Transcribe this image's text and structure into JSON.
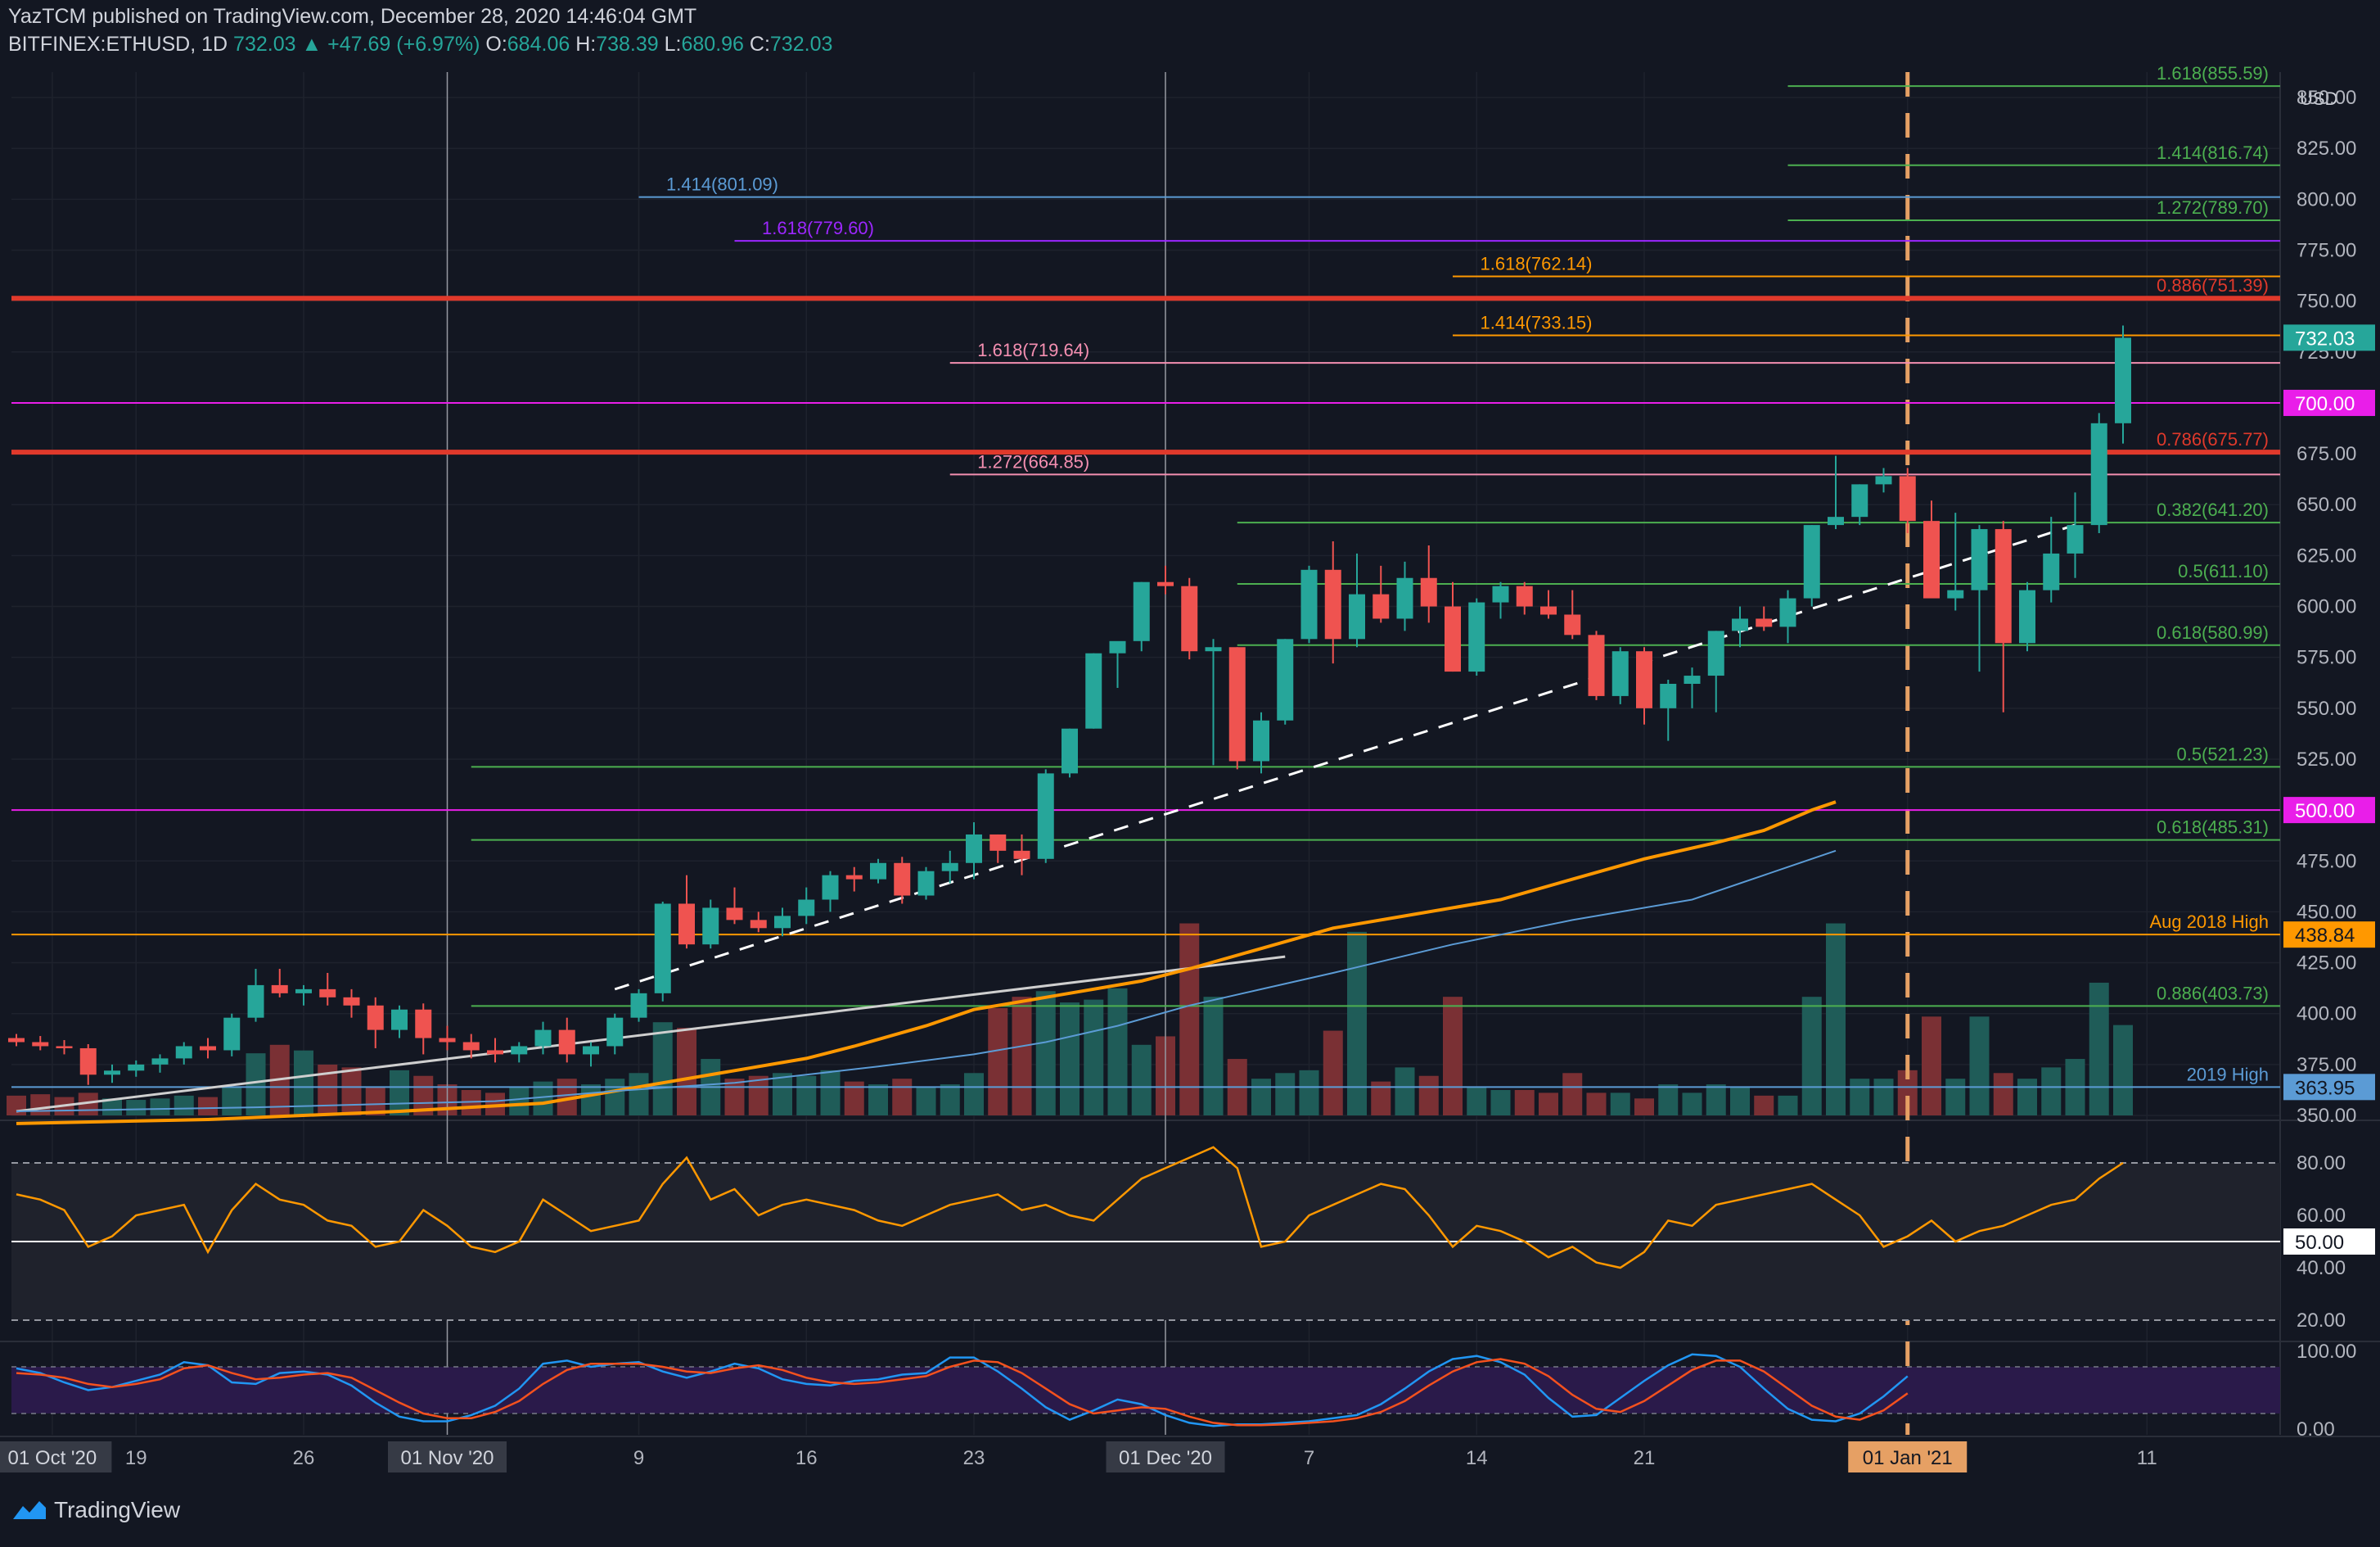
{
  "header": {
    "publisher_line": "YazTCM published on TradingView.com, December 28, 2020 14:46:04 GMT",
    "symbol": "BITFINEX:ETHUSD, 1D",
    "last": "732.03",
    "change_arrow": "▲",
    "change": "+47.69 (+6.97%)",
    "open_label": "O:",
    "open": "684.06",
    "high_label": "H:",
    "high": "738.39",
    "low_label": "L:",
    "low": "680.96",
    "close_label": "C:",
    "close": "732.03"
  },
  "footer": {
    "brand": "TradingView"
  },
  "colors": {
    "background": "#131722",
    "up": "#26a69a",
    "down": "#ef5350",
    "vol_up": "#1f5c58",
    "vol_down": "#7a3034",
    "resistance": "#e0392b",
    "magenta": "#e91ee9",
    "orange": "#ff9800",
    "green_fib": "#4caf50",
    "pink_fib": "#f48fb1",
    "blue_fib": "#5b9bd5",
    "purple_fib": "#9c27ff",
    "rsi": "#ff9800",
    "stoch_k": "#2196f3",
    "stoch_d": "#f4511e",
    "dashed_vertical": "#e6a064"
  },
  "chart_data": {
    "type": "candlestick",
    "currency": "USD",
    "y_axis": {
      "min": 350,
      "max": 862.5,
      "ticks": [
        "350.00",
        "375.00",
        "400.00",
        "425.00",
        "450.00",
        "475.00",
        "500.00",
        "525.00",
        "550.00",
        "575.00",
        "600.00",
        "625.00",
        "650.00",
        "675.00",
        "700.00",
        "725.00",
        "750.00",
        "775.00",
        "800.00",
        "825.00",
        "850.00"
      ]
    },
    "x_ticks": [
      {
        "label": "01 Oct '20",
        "idx": 1.5,
        "boxed": true
      },
      {
        "label": "19",
        "idx": 5
      },
      {
        "label": "26",
        "idx": 12
      },
      {
        "label": "01 Nov '20",
        "idx": 18,
        "boxed": true
      },
      {
        "label": "9",
        "idx": 26
      },
      {
        "label": "16",
        "idx": 33
      },
      {
        "label": "23",
        "idx": 40
      },
      {
        "label": "01 Dec '20",
        "idx": 48,
        "boxed": true
      },
      {
        "label": "7",
        "idx": 54
      },
      {
        "label": "14",
        "idx": 61
      },
      {
        "label": "21",
        "idx": 68
      },
      {
        "label": "01 Jan '21",
        "idx": 79,
        "boxed": true,
        "accent": true
      },
      {
        "label": "11",
        "idx": 89
      }
    ],
    "candles": [
      [
        388,
        390,
        384,
        386
      ],
      [
        386,
        389,
        382,
        384
      ],
      [
        384,
        387,
        380,
        383
      ],
      [
        383,
        385,
        365,
        370
      ],
      [
        370,
        375,
        366,
        372
      ],
      [
        372,
        377,
        369,
        375
      ],
      [
        375,
        380,
        371,
        378
      ],
      [
        378,
        386,
        375,
        384
      ],
      [
        384,
        388,
        378,
        382
      ],
      [
        382,
        400,
        379,
        398
      ],
      [
        398,
        422,
        396,
        414
      ],
      [
        414,
        422,
        408,
        410
      ],
      [
        410,
        414,
        404,
        412
      ],
      [
        412,
        420,
        404,
        408
      ],
      [
        408,
        412,
        398,
        404
      ],
      [
        404,
        408,
        383,
        392
      ],
      [
        392,
        404,
        388,
        402
      ],
      [
        402,
        405,
        380,
        388
      ],
      [
        388,
        394,
        382,
        386
      ],
      [
        386,
        390,
        378,
        382
      ],
      [
        382,
        388,
        376,
        380
      ],
      [
        380,
        386,
        376,
        384
      ],
      [
        384,
        396,
        380,
        392
      ],
      [
        392,
        398,
        376,
        380
      ],
      [
        380,
        386,
        374,
        384
      ],
      [
        384,
        400,
        380,
        398
      ],
      [
        398,
        412,
        396,
        410
      ],
      [
        410,
        455,
        406,
        454
      ],
      [
        454,
        468,
        432,
        434
      ],
      [
        434,
        456,
        432,
        452
      ],
      [
        452,
        462,
        444,
        446
      ],
      [
        446,
        450,
        440,
        442
      ],
      [
        442,
        452,
        438,
        448
      ],
      [
        448,
        462,
        444,
        456
      ],
      [
        456,
        470,
        450,
        468
      ],
      [
        468,
        472,
        460,
        466
      ],
      [
        466,
        476,
        464,
        474
      ],
      [
        474,
        477,
        454,
        458
      ],
      [
        458,
        472,
        456,
        470
      ],
      [
        470,
        480,
        464,
        474
      ],
      [
        474,
        494,
        466,
        488
      ],
      [
        488,
        488,
        474,
        480
      ],
      [
        480,
        488,
        468,
        476
      ],
      [
        476,
        520,
        474,
        518
      ],
      [
        518,
        540,
        516,
        540
      ],
      [
        540,
        577,
        540,
        577
      ],
      [
        577,
        582,
        560,
        583
      ],
      [
        583,
        612,
        578,
        612
      ],
      [
        612,
        620,
        606,
        610
      ],
      [
        610,
        614,
        574,
        578
      ],
      [
        578,
        584,
        522,
        580
      ],
      [
        580,
        580,
        520,
        524
      ],
      [
        524,
        548,
        518,
        544
      ],
      [
        544,
        584,
        542,
        584
      ],
      [
        584,
        620,
        582,
        618
      ],
      [
        618,
        632,
        572,
        584
      ],
      [
        584,
        626,
        580,
        606
      ],
      [
        606,
        620,
        592,
        594
      ],
      [
        594,
        622,
        588,
        614
      ],
      [
        614,
        630,
        592,
        600
      ],
      [
        600,
        612,
        568,
        568
      ],
      [
        568,
        604,
        566,
        602
      ],
      [
        602,
        612,
        594,
        610
      ],
      [
        610,
        612,
        596,
        600
      ],
      [
        600,
        608,
        594,
        596
      ],
      [
        596,
        608,
        584,
        586
      ],
      [
        586,
        588,
        554,
        556
      ],
      [
        556,
        580,
        552,
        578
      ],
      [
        578,
        580,
        542,
        550
      ],
      [
        550,
        564,
        534,
        562
      ],
      [
        562,
        570,
        550,
        566
      ],
      [
        566,
        588,
        548,
        588
      ],
      [
        588,
        600,
        580,
        594
      ],
      [
        594,
        600,
        588,
        590
      ],
      [
        590,
        608,
        582,
        604
      ],
      [
        604,
        640,
        600,
        640
      ],
      [
        640,
        674,
        638,
        644
      ],
      [
        644,
        660,
        640,
        660
      ],
      [
        660,
        668,
        656,
        664
      ],
      [
        664,
        668,
        636,
        642
      ],
      [
        642,
        652,
        620,
        604
      ],
      [
        604,
        646,
        598,
        608
      ],
      [
        608,
        640,
        568,
        638
      ],
      [
        638,
        642,
        548,
        582
      ],
      [
        582,
        612,
        578,
        608
      ],
      [
        608,
        644,
        602,
        626
      ],
      [
        626,
        656,
        614,
        640
      ],
      [
        640,
        695,
        636,
        690
      ],
      [
        690,
        738,
        680,
        732
      ]
    ],
    "volume_max": 145,
    "volumes": [
      14,
      15,
      13,
      16,
      12,
      11,
      12,
      14,
      13,
      20,
      44,
      50,
      46,
      36,
      34,
      20,
      32,
      28,
      22,
      18,
      16,
      20,
      24,
      26,
      22,
      26,
      30,
      66,
      62,
      40,
      26,
      28,
      30,
      28,
      32,
      24,
      22,
      26,
      20,
      22,
      30,
      76,
      84,
      88,
      80,
      82,
      90,
      50,
      56,
      136,
      84,
      40,
      26,
      30,
      32,
      60,
      130,
      24,
      34,
      28,
      84,
      20,
      18,
      18,
      16,
      30,
      16,
      16,
      12,
      22,
      16,
      22,
      20,
      14,
      14,
      84,
      136,
      26,
      26,
      32,
      70,
      26,
      70,
      30,
      26,
      34,
      40,
      94,
      64
    ],
    "sma_short": [
      [
        0,
        352
      ],
      [
        10,
        354
      ],
      [
        20,
        357
      ],
      [
        25,
        362
      ],
      [
        30,
        366
      ],
      [
        33,
        370
      ],
      [
        36,
        374
      ],
      [
        40,
        380
      ],
      [
        43,
        386
      ],
      [
        46,
        394
      ],
      [
        49,
        404
      ],
      [
        52,
        412
      ],
      [
        55,
        420
      ],
      [
        60,
        434
      ],
      [
        65,
        446
      ],
      [
        70,
        456
      ],
      [
        74,
        472
      ],
      [
        76,
        480
      ]
    ],
    "sma_long": [
      [
        0,
        346
      ],
      [
        8,
        348
      ],
      [
        16,
        352
      ],
      [
        22,
        356
      ],
      [
        26,
        364
      ],
      [
        30,
        372
      ],
      [
        33,
        378
      ],
      [
        35,
        384
      ],
      [
        38,
        394
      ],
      [
        40,
        402
      ],
      [
        42,
        406
      ],
      [
        44,
        410
      ],
      [
        47,
        416
      ],
      [
        49,
        422
      ],
      [
        52,
        432
      ],
      [
        55,
        442
      ],
      [
        58,
        448
      ],
      [
        62,
        456
      ],
      [
        65,
        466
      ],
      [
        68,
        476
      ],
      [
        71,
        484
      ],
      [
        73,
        490
      ],
      [
        75,
        500
      ],
      [
        76,
        504
      ]
    ],
    "trendlines": [
      {
        "name": "white-solid",
        "from": [
          0,
          352
        ],
        "to": [
          53,
          428
        ],
        "color": "#cfcfcf",
        "dash": false
      },
      {
        "name": "white-dashed",
        "from": [
          25,
          412
        ],
        "to": [
          86,
          640
        ],
        "color": "#ffffff",
        "dash": true
      }
    ],
    "levels": [
      {
        "value": 855.59,
        "label": "1.618(855.59)",
        "color": "#4caf50",
        "start": 74,
        "label_side": "right"
      },
      {
        "value": 816.74,
        "label": "1.414(816.74)",
        "color": "#4caf50",
        "start": 74,
        "label_side": "right"
      },
      {
        "value": 801.09,
        "label": "1.414(801.09)",
        "color": "#5b9bd5",
        "start": 26,
        "label_side": "left"
      },
      {
        "value": 789.7,
        "label": "1.272(789.70)",
        "color": "#4caf50",
        "start": 74,
        "label_side": "right"
      },
      {
        "value": 779.6,
        "label": "1.618(779.60)",
        "color": "#9c27ff",
        "start": 30,
        "label_side": "left"
      },
      {
        "value": 762.14,
        "label": "1.618(762.14)",
        "color": "#ff9800",
        "start": 60,
        "label_side": "left"
      },
      {
        "value": 751.39,
        "label": "0.886(751.39)",
        "color": "#e0392b",
        "start": 0,
        "label_side": "right",
        "thick": true
      },
      {
        "value": 733.15,
        "label": "1.414(733.15)",
        "color": "#ff9800",
        "start": 60,
        "label_side": "left"
      },
      {
        "value": 719.64,
        "label": "1.618(719.64)",
        "color": "#f48fb1",
        "start": 39,
        "label_side": "left"
      },
      {
        "value": 700.0,
        "label": "",
        "color": "#e91ee9",
        "start": 0,
        "label_side": "none"
      },
      {
        "value": 675.77,
        "label": "0.786(675.77)",
        "color": "#e0392b",
        "start": 0,
        "label_side": "right",
        "thick": true
      },
      {
        "value": 664.85,
        "label": "1.272(664.85)",
        "color": "#f48fb1",
        "start": 39,
        "label_side": "left"
      },
      {
        "value": 641.2,
        "label": "0.382(641.20)",
        "color": "#4caf50",
        "start": 51,
        "label_side": "right"
      },
      {
        "value": 611.1,
        "label": "0.5(611.10)",
        "color": "#4caf50",
        "start": 51,
        "label_side": "right"
      },
      {
        "value": 580.99,
        "label": "0.618(580.99)",
        "color": "#4caf50",
        "start": 51,
        "label_side": "right"
      },
      {
        "value": 521.23,
        "label": "0.5(521.23)",
        "color": "#4caf50",
        "start": 19,
        "label_side": "right"
      },
      {
        "value": 500.0,
        "label": "",
        "color": "#e91ee9",
        "start": 0,
        "label_side": "none"
      },
      {
        "value": 485.31,
        "label": "0.618(485.31)",
        "color": "#4caf50",
        "start": 19,
        "label_side": "right"
      },
      {
        "value": 438.84,
        "label": "Aug 2018 High",
        "color": "#ff9800",
        "start": 0,
        "label_side": "right"
      },
      {
        "value": 403.73,
        "label": "0.886(403.73)",
        "color": "#4caf50",
        "start": 19,
        "label_side": "right"
      },
      {
        "value": 363.95,
        "label": "2019 High",
        "color": "#5b9bd5",
        "start": 0,
        "label_side": "right"
      }
    ],
    "price_tags": [
      {
        "value": 732.03,
        "text": "732.03",
        "bg": "#26a69a",
        "fg": "#ffffff"
      },
      {
        "value": 700.0,
        "text": "700.00",
        "bg": "#e91ee9",
        "fg": "#ffffff"
      },
      {
        "value": 500.0,
        "text": "500.00",
        "bg": "#e91ee9",
        "fg": "#ffffff"
      },
      {
        "value": 438.84,
        "text": "438.84",
        "bg": "#ff9800",
        "fg": "#131722"
      },
      {
        "value": 363.95,
        "text": "363.95",
        "bg": "#5b9bd5",
        "fg": "#131722"
      }
    ],
    "vertical_markers": [
      18,
      48
    ],
    "projection_idx": 79,
    "rsi": {
      "ticks": [
        "80.00",
        "60.00",
        "40.00",
        "20.00"
      ],
      "tick_values": [
        80,
        60,
        40,
        20
      ],
      "midline_label": "50.00",
      "midline_value": 50,
      "values": [
        68,
        66,
        62,
        48,
        52,
        60,
        62,
        64,
        46,
        62,
        72,
        66,
        64,
        58,
        56,
        48,
        50,
        62,
        56,
        48,
        46,
        50,
        66,
        60,
        54,
        56,
        58,
        72,
        82,
        66,
        70,
        60,
        64,
        66,
        64,
        62,
        58,
        56,
        60,
        64,
        66,
        68,
        62,
        64,
        60,
        58,
        66,
        74,
        78,
        82,
        86,
        78,
        48,
        50,
        60,
        64,
        68,
        72,
        70,
        60,
        48,
        56,
        54,
        50,
        44,
        48,
        42,
        40,
        46,
        58,
        56,
        64,
        66,
        68,
        70,
        72,
        66,
        60,
        48,
        52,
        58,
        50,
        54,
        56,
        60,
        64,
        66,
        74,
        80
      ]
    },
    "stoch": {
      "ticks": [
        "100.00",
        "0.00"
      ],
      "tick_values": [
        100,
        0
      ],
      "k": [
        78,
        72,
        60,
        50,
        54,
        62,
        70,
        86,
        82,
        60,
        58,
        72,
        74,
        70,
        56,
        34,
        16,
        10,
        10,
        18,
        30,
        52,
        84,
        88,
        80,
        84,
        86,
        74,
        66,
        74,
        84,
        78,
        64,
        58,
        56,
        62,
        64,
        70,
        72,
        92,
        92,
        74,
        52,
        28,
        12,
        24,
        38,
        32,
        18,
        8,
        4,
        6,
        6,
        8,
        10,
        14,
        18,
        32,
        52,
        74,
        90,
        94,
        86,
        70,
        40,
        16,
        18,
        40,
        62,
        82,
        96,
        94,
        80,
        52,
        26,
        12,
        10,
        20,
        42,
        68
      ],
      "d": [
        72,
        70,
        66,
        58,
        54,
        58,
        64,
        78,
        82,
        72,
        64,
        66,
        70,
        72,
        66,
        50,
        34,
        20,
        14,
        14,
        22,
        36,
        58,
        76,
        84,
        84,
        84,
        80,
        74,
        72,
        78,
        82,
        76,
        66,
        60,
        58,
        60,
        64,
        68,
        80,
        88,
        86,
        72,
        52,
        32,
        20,
        24,
        28,
        26,
        16,
        8,
        5,
        5,
        6,
        8,
        10,
        14,
        22,
        36,
        56,
        74,
        86,
        90,
        84,
        68,
        44,
        26,
        22,
        36,
        56,
        76,
        88,
        88,
        74,
        52,
        30,
        16,
        12,
        24,
        46
      ]
    }
  }
}
